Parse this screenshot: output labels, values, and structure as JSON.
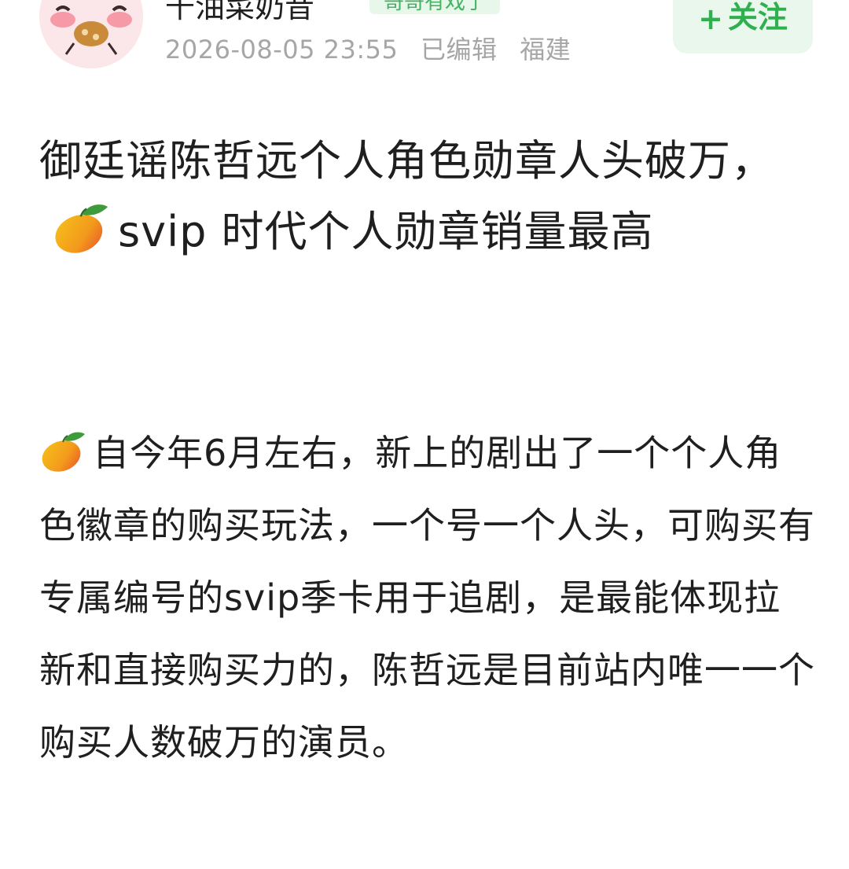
{
  "header": {
    "username": "千油菜奶昔",
    "tag": "哥哥有戏了",
    "timestamp": "2026-08-05 23:55",
    "edited": "已编辑",
    "location": "福建",
    "follow_label": "关注",
    "follow_plus": "+"
  },
  "post": {
    "title_part1": "御廷谣陈哲远个人角色勋章人头破万，",
    "title_emoji": "mango-emoji",
    "title_part2": "svip 时代个人勋章销量最高",
    "body_emoji": "mango-emoji",
    "body_text": "自今年6月左右，新上的剧出了一个个人角色徽章的购买玩法，一个号一个人头，可购买有专属编号的svip季卡用于追剧，是最能体现拉新和直接购买力的，陈哲远是目前站内唯一一个购买人数破万的演员。"
  },
  "colors": {
    "accent_green": "#2fb04e",
    "follow_bg": "#e9f7ec",
    "meta_gray": "#a6a6a6",
    "text": "#1f1f1f"
  }
}
